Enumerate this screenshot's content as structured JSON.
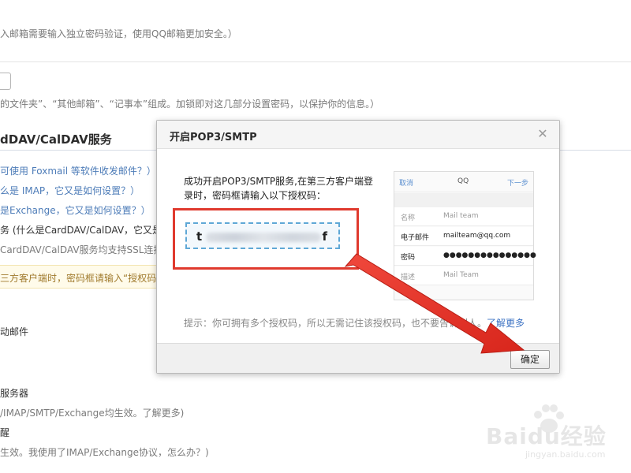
{
  "background": {
    "lines": [
      "入邮箱需要输入独立密码验证，使用QQ邮箱更加安全。）",
      "的文件夹”、“其他邮箱”、“记事本”组成。加锁即对这几部分设置密码，以保护你的信息。）",
      "可使用 Foxmail 等软件收发邮件？）",
      "么是 IMAP，它又是如何设置？）",
      "是Exchange，它又是如何设置？）",
      "务 (什么是CardDAV/CalDAV，它又是",
      "CardDAV/CalDAV服务均支持SSL连接",
      "三方客户端时，密码框请输入“授权码”",
      "动邮件",
      "服务器",
      "/IMAP/SMTP/Exchange均生效。了解更多)",
      "醒",
      "生效。我使用了IMAP/Exchange协议，怎么办？)"
    ],
    "section_title": "dDAV/CalDAV服务"
  },
  "modal": {
    "title": "开启POP3/SMTP",
    "close_glyph": "✕",
    "message": "成功开启POP3/SMTP服务,在第三方客户端登录时，密码框请输入以下授权码：",
    "code_first": "t",
    "code_last": "f",
    "phone": {
      "cancel": "取消",
      "title": "QQ",
      "next": "下一步",
      "rows": [
        {
          "key": "名称",
          "value": "Mail team"
        },
        {
          "key": "电子邮件",
          "value": "mailteam@qq.com"
        },
        {
          "key": "密码",
          "value": "●●●●●●●●●●●●●●●"
        },
        {
          "key": "描述",
          "value": "Mail Team"
        }
      ]
    },
    "hint": "提示：你可拥有多个授权码，所以无需记住该授权码，也不要告诉别人。",
    "hint_link": "了解更多",
    "ok_label": "确定"
  },
  "watermark": {
    "brand": "Baidu经验",
    "sub": "jingyan.baidu.com"
  },
  "colors": {
    "annotation_red": "#e03a2e",
    "link_blue": "#4d7cb8"
  }
}
